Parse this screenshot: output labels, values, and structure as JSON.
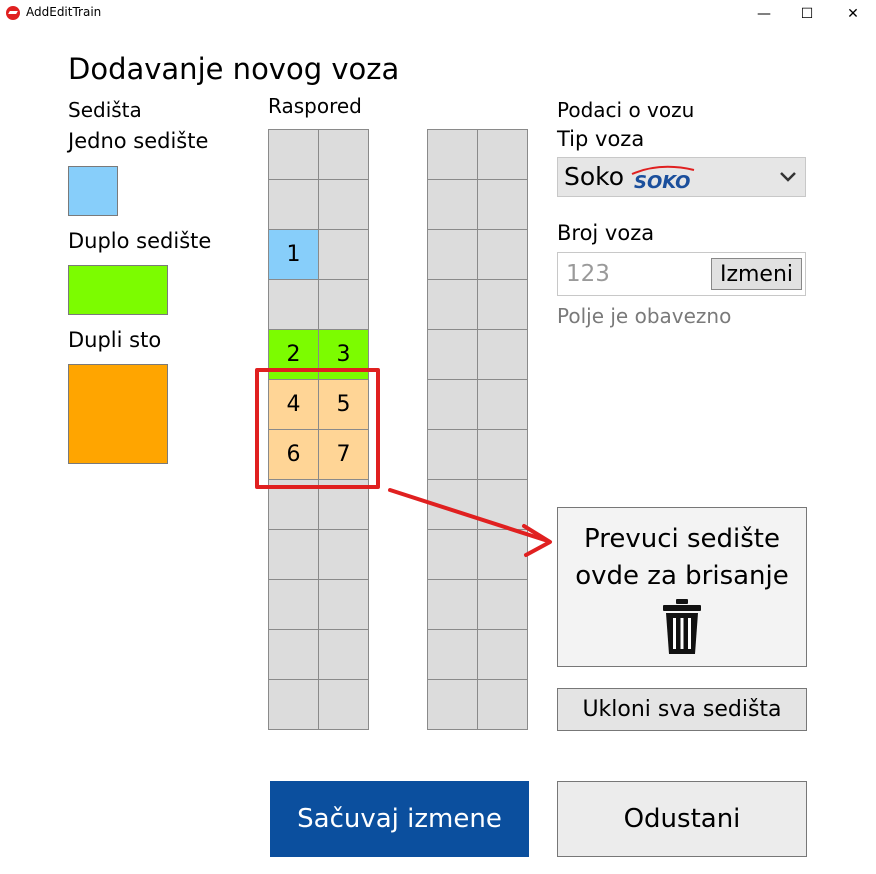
{
  "window": {
    "title": "AddEditTrain",
    "minimize": "—",
    "maximize": "☐",
    "close": "✕"
  },
  "heading": "Dodavanje novog voza",
  "legend": {
    "title": "Sedišta",
    "single": "Jedno sedište",
    "double": "Duplo sedište",
    "table": "Dupli sto"
  },
  "layout_label": "Raspored",
  "seats": {
    "s1": "1",
    "s2": "2",
    "s3": "3",
    "s4": "4",
    "s5": "5",
    "s6": "6",
    "s7": "7"
  },
  "train_data": {
    "title": "Podaci o vozu",
    "type_label": "Tip voza",
    "type_value": "Soko",
    "type_logo": "SOKO",
    "number_label": "Broj voza",
    "number_placeholder": "123",
    "edit_button": "Izmeni",
    "required_hint": "Polje je obavezno"
  },
  "trash": {
    "line1": "Prevuci sedište",
    "line2": "ovde za brisanje"
  },
  "remove_all_button": "Ukloni sva sedišta",
  "save_button": "Sačuvaj izmene",
  "cancel_button": "Odustani",
  "colors": {
    "single_seat": "#87cefa",
    "double_seat": "#7cfc00",
    "table_seat": "#ffa500",
    "save_button": "#0b4f9e",
    "annotation": "#e02020"
  }
}
